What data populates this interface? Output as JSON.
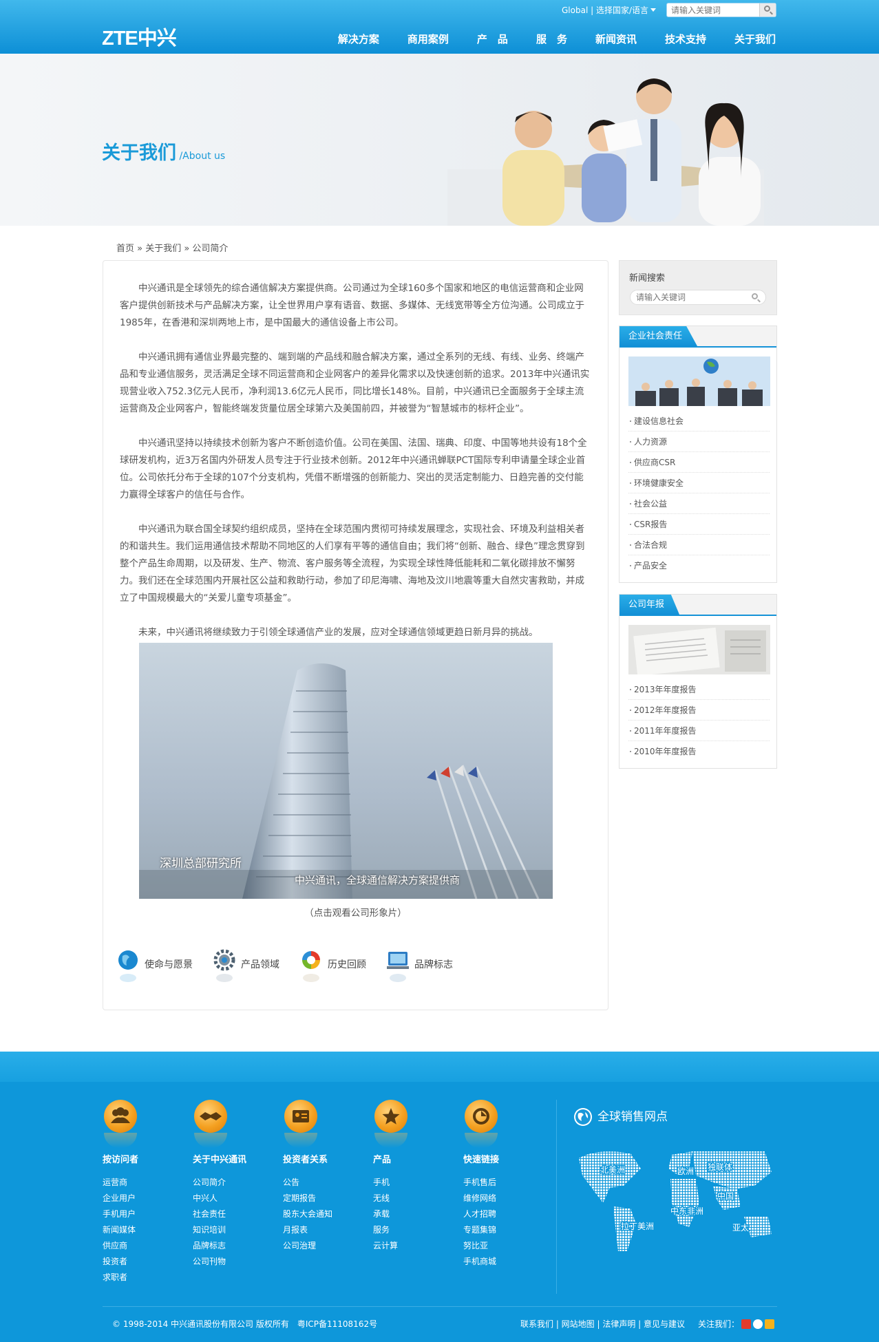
{
  "header": {
    "logo": "ZTE中兴",
    "global_link": "Global | 选择国家/语言",
    "search_placeholder": "请输入关键词",
    "nav": [
      "解决方案",
      "商用案例",
      "产　品",
      "服　务",
      "新闻资讯",
      "技术支持",
      "关于我们"
    ]
  },
  "banner": {
    "title": "关于我们",
    "subtitle": " /About us"
  },
  "breadcrumb": "首页 » 关于我们 » 公司简介",
  "article": {
    "paragraphs": [
      "中兴通讯是全球领先的综合通信解决方案提供商。公司通过为全球160多个国家和地区的电信运营商和企业网客户提供创新技术与产品解决方案，让全世界用户享有语音、数据、多媒体、无线宽带等全方位沟通。公司成立于1985年，在香港和深圳两地上市，是中国最大的通信设备上市公司。",
      "中兴通讯拥有通信业界最完整的、端到端的产品线和融合解决方案，通过全系列的无线、有线、业务、终端产品和专业通信服务，灵活满足全球不同运营商和企业网客户的差异化需求以及快速创新的追求。2013年中兴通讯实现营业收入752.3亿元人民币，净利润13.6亿元人民币，同比增长148%。目前，中兴通讯已全面服务于全球主流运营商及企业网客户，智能终端发货量位居全球第六及美国前四，并被誉为“智慧城市的标杆企业”。",
      "中兴通讯坚持以持续技术创新为客户不断创造价值。公司在美国、法国、瑞典、印度、中国等地共设有18个全球研发机构，近3万名国内外研发人员专注于行业技术创新。2012年中兴通讯蝉联PCT国际专利申请量全球企业首位。公司依托分布于全球的107个分支机构，凭借不断增强的创新能力、突出的灵活定制能力、日趋完善的交付能力赢得全球客户的信任与合作。",
      "中兴通讯为联合国全球契约组织成员，坚持在全球范围内贯彻可持续发展理念，实现社会、环境及利益相关者的和谐共生。我们运用通信技术帮助不同地区的人们享有平等的通信自由；我们将“创新、融合、绿色”理念贯穿到整个产品生命周期，以及研发、生产、物流、客户服务等全流程，为实现全球性降低能耗和二氧化碳排放不懈努力。我们还在全球范围内开展社区公益和救助行动，参加了印尼海啸、海地及汶川地震等重大自然灾害救助，并成立了中国规模最大的“关爱儿童专项基金”。",
      "未来，中兴通讯将继续致力于引领全球通信产业的发展，应对全球通信领域更趋日新月异的挑战。"
    ],
    "video_text_1": "深圳总部研究所",
    "video_text_2": "中兴通讯，全球通信解决方案提供商",
    "video_caption": "（点击观看公司形象片）",
    "icon_links": [
      "使命与愿景",
      "产品领域",
      "历史回顾",
      "品牌标志"
    ]
  },
  "sidebar": {
    "news_search_title": "新闻搜索",
    "news_search_placeholder": "请输入关键词",
    "csr_tab": "企业社会责任",
    "csr_items": [
      "建设信息社会",
      "人力资源",
      "供应商CSR",
      "环境健康安全",
      "社会公益",
      "CSR报告",
      "合法合规",
      "产品安全"
    ],
    "annual_tab": "公司年报",
    "annual_items": [
      "2013年年度报告",
      "2012年年度报告",
      "2011年年度报告",
      "2010年年度报告"
    ]
  },
  "footer": {
    "columns": [
      {
        "title": "按访问者",
        "icon": "people-icon",
        "items": [
          "运营商",
          "企业用户",
          "手机用户",
          "新闻媒体",
          "供应商",
          "投资者",
          "求职者"
        ]
      },
      {
        "title": "关于中兴通讯",
        "icon": "handshake-icon",
        "items": [
          "公司简介",
          "中兴人",
          "社会责任",
          "知识培训",
          "品牌标志",
          "公司刊物"
        ]
      },
      {
        "title": "投资者关系",
        "icon": "id-card-icon",
        "items": [
          "公告",
          "定期报告",
          "股东大会通知",
          "月报表",
          "公司治理"
        ]
      },
      {
        "title": "产品",
        "icon": "star-icon",
        "items": [
          "手机",
          "无线",
          "承载",
          "服务",
          "云计算"
        ]
      },
      {
        "title": "快速链接",
        "icon": "link-icon",
        "items": [
          "手机售后",
          "维修网络",
          "人才招聘",
          "专题集锦",
          "努比亚",
          "手机商城"
        ]
      }
    ],
    "global_title": "全球销售网点",
    "map_labels": [
      "北美洲",
      "欧洲",
      "独联体",
      "中国",
      "中东非洲",
      "亚太",
      "拉丁美洲"
    ],
    "copyright": "© 1998-2014 中兴通讯股份有限公司 版权所有　粤ICP备11108162号",
    "links": "联系我们 | 网站地图 | 法律声明 | 意见与建议",
    "follow": "关注我们："
  }
}
